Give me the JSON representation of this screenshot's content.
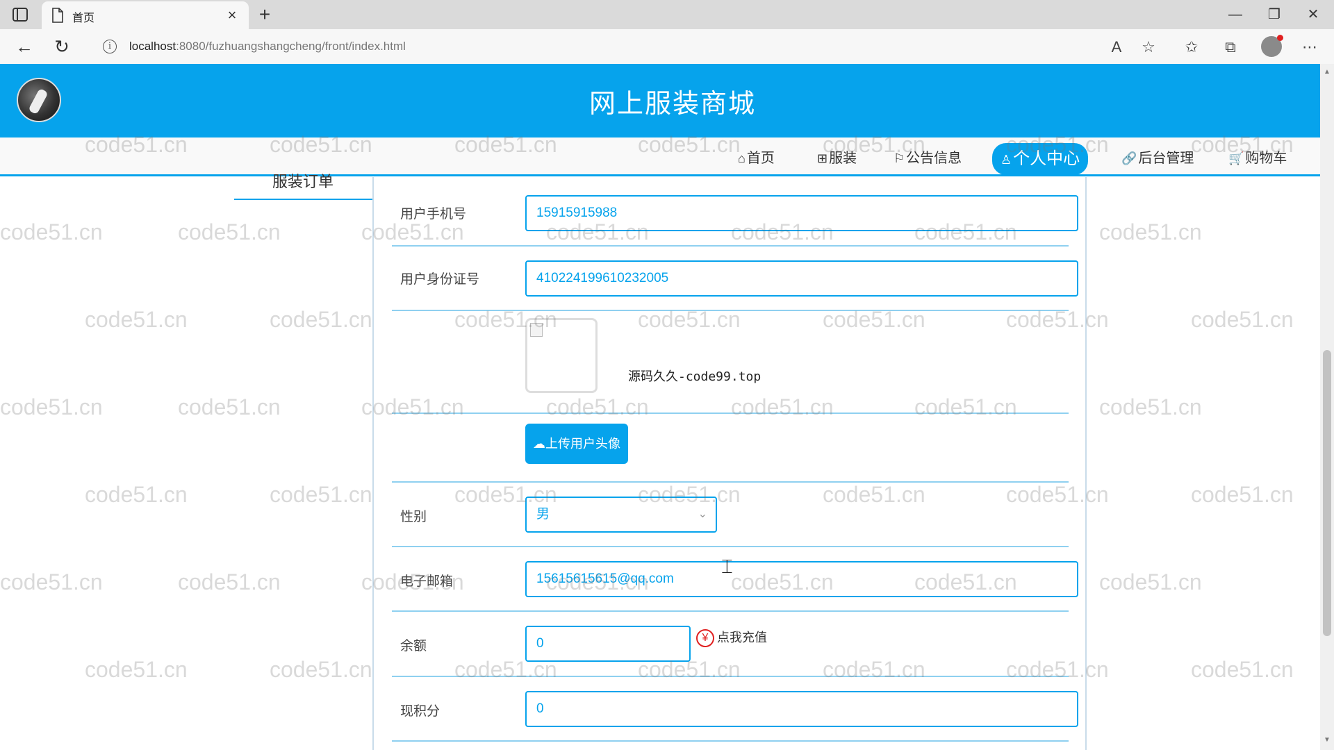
{
  "browser": {
    "tab_title": "首页",
    "url_host": "localhost",
    "url_rest": ":8080/fuzhuangshangcheng/front/index.html",
    "icons": [
      "sidebar-toggle-icon",
      "page-icon",
      "close-icon",
      "plus-icon",
      "back-icon",
      "refresh-icon",
      "info-icon",
      "read-aloud-icon",
      "favorite-add-icon",
      "favorites-icon",
      "collections-icon",
      "profile-icon",
      "more-icon",
      "minimize-icon",
      "maximize-icon",
      "window-close-icon"
    ]
  },
  "site": {
    "title": "网上服装商城",
    "accent": "#06a3ec"
  },
  "nav": [
    {
      "label": "首页",
      "glyph": "⌂"
    },
    {
      "label": "服装",
      "glyph": "⊞"
    },
    {
      "label": "公告信息",
      "glyph": "⚐"
    },
    {
      "label": "个人中心",
      "glyph": "♙",
      "active": true
    },
    {
      "label": "后台管理",
      "glyph": "🔗"
    },
    {
      "label": "购物车",
      "glyph": "🛒"
    }
  ],
  "sidebar": {
    "item_label": "服装订单"
  },
  "form": {
    "phone_label": "用户手机号",
    "phone_value": "15915915988",
    "idcard_label": "用户身份证号",
    "idcard_value": "410224199610232005",
    "avatar_note": "源码久久-code99.top",
    "upload_label": "上传用户头像",
    "gender_label": "性别",
    "gender_value": "男",
    "email_label": "电子邮箱",
    "email_value": "15615615615@qq.com",
    "balance_label": "余额",
    "balance_value": "0",
    "recharge_label": "点我充值",
    "points_label": "现积分",
    "points_value": "0"
  },
  "watermark": "code51.cn"
}
